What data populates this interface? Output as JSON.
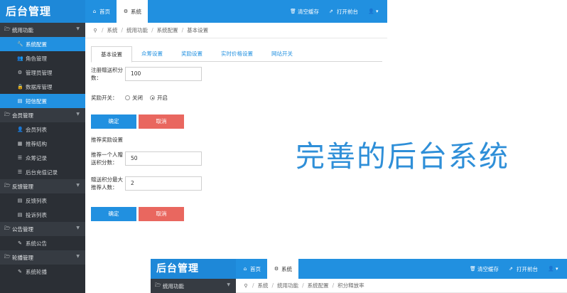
{
  "app": {
    "brand": "后台管理"
  },
  "topbar": {
    "tabs": [
      {
        "label": "首页",
        "icon": "home-icon"
      },
      {
        "label": "系统",
        "icon": "gear-icon"
      }
    ],
    "actions": {
      "clear_cache": "清空缓存",
      "open_frontend": "打开前台"
    }
  },
  "sidebar": {
    "groups": [
      {
        "label": "统用功能",
        "items": [
          "系统配置",
          "角色管理",
          "管理员管理",
          "数据库管理",
          "短信配置"
        ]
      },
      {
        "label": "会员管理",
        "items": [
          "会员列表",
          "推荐结构",
          "众筹记录",
          "后台充值记录"
        ]
      },
      {
        "label": "反馈管理",
        "items": [
          "反馈列表",
          "投诉列表"
        ]
      },
      {
        "label": "公告管理",
        "items": [
          "系统公告"
        ]
      },
      {
        "label": "轮播管理",
        "items": [
          "系统轮播"
        ]
      }
    ]
  },
  "breadcrumb": [
    "系统",
    "统用功能",
    "系统配置",
    "基本设置"
  ],
  "tabs": [
    "基本设置",
    "众筹设置",
    "奖励设置",
    "实时价格设置",
    "网站开关"
  ],
  "form": {
    "register_points_label": "注册赠送积分数：",
    "register_points_value": "100",
    "reward_switch_label": "奖励开关：",
    "radio_off": "关闭",
    "radio_on": "开启",
    "confirm": "确定",
    "cancel": "取消",
    "recommend_section": "推荐奖励设置",
    "recommend_points_label": "推荐一个人赠送积分数：",
    "recommend_points_value": "50",
    "max_recommend_label": "赠送积分最大推荐人数：",
    "max_recommend_value": "2",
    "confirm2": "确定",
    "cancel2": "取消"
  },
  "caption": "完善的后台系统",
  "window2": {
    "brand": "后台管理",
    "tabs": [
      "首页",
      "系统"
    ],
    "actions": {
      "clear_cache": "清空缓存",
      "open_frontend": "打开前台"
    },
    "sidebar_group": "统用功能",
    "breadcrumb": [
      "系统",
      "统用功能",
      "系统配置",
      "积分释放率"
    ]
  }
}
